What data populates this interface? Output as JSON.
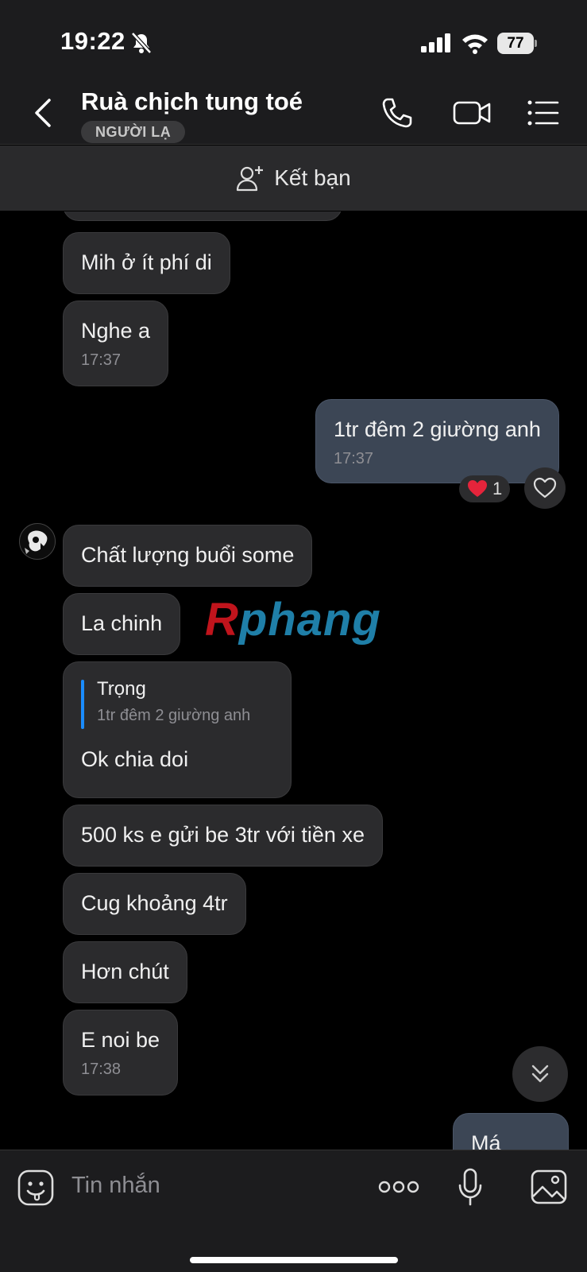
{
  "status_bar": {
    "time": "19:22",
    "battery": "77"
  },
  "header": {
    "title": "Ruà chịch tung toé",
    "badge": "NGƯỜI LẠ"
  },
  "friend_bar": {
    "label": "Kết bạn"
  },
  "messages": {
    "m1": {
      "text": "Mih ở ít phí di"
    },
    "m2": {
      "text": "Nghe a",
      "time": "17:37"
    },
    "m3": {
      "text": "1tr đêm 2 giường anh",
      "time": "17:37"
    },
    "m3_reaction_count": "1",
    "m4": {
      "text": "Chất lượng buổi some"
    },
    "m5": {
      "text": "La chinh"
    },
    "m6": {
      "quote_name": "Trọng",
      "quote_text": "1tr đêm 2 giường anh",
      "text": "Ok chia doi"
    },
    "m7": {
      "text": "500 ks e gửi be 3tr với tiền xe"
    },
    "m8": {
      "text": "Cug khoảng 4tr"
    },
    "m9": {
      "text": "Hơn chút"
    },
    "m10": {
      "text": "E noi be",
      "time": "17:38"
    },
    "m11": {
      "text": "Má"
    }
  },
  "watermark": {
    "first": "R",
    "rest": "phang"
  },
  "input": {
    "placeholder": "Tin nhắn"
  },
  "colors": {
    "my_bubble": "#3c4655",
    "their_bubble": "#2b2b2d",
    "accent": "#1a8cff"
  }
}
